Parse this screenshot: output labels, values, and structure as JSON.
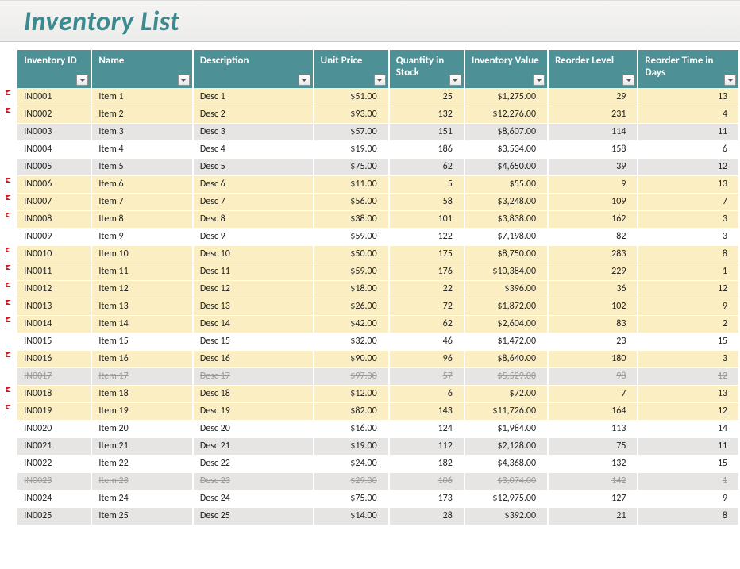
{
  "title": "Inventory List",
  "columns": {
    "id": "Inventory ID",
    "name": "Name",
    "desc": "Description",
    "price": "Unit Price",
    "qty": "Quantity in Stock",
    "val": "Inventory Value",
    "rlvl": "Reorder Level",
    "rtime": "Reorder Time in Days"
  },
  "rows": [
    {
      "flag": true,
      "hl": true,
      "id": "IN0001",
      "name": "Item 1",
      "desc": "Desc 1",
      "price": "$51.00",
      "qty": "25",
      "val": "$1,275.00",
      "rlvl": "29",
      "rtime": "13"
    },
    {
      "flag": true,
      "hl": true,
      "id": "IN0002",
      "name": "Item 2",
      "desc": "Desc 2",
      "price": "$93.00",
      "qty": "132",
      "val": "$12,276.00",
      "rlvl": "231",
      "rtime": "4"
    },
    {
      "flag": false,
      "hl": false,
      "gray": true,
      "id": "IN0003",
      "name": "Item 3",
      "desc": "Desc 3",
      "price": "$57.00",
      "qty": "151",
      "val": "$8,607.00",
      "rlvl": "114",
      "rtime": "11"
    },
    {
      "flag": false,
      "hl": false,
      "id": "IN0004",
      "name": "Item 4",
      "desc": "Desc 4",
      "price": "$19.00",
      "qty": "186",
      "val": "$3,534.00",
      "rlvl": "158",
      "rtime": "6"
    },
    {
      "flag": false,
      "hl": false,
      "gray": true,
      "id": "IN0005",
      "name": "Item 5",
      "desc": "Desc 5",
      "price": "$75.00",
      "qty": "62",
      "val": "$4,650.00",
      "rlvl": "39",
      "rtime": "12"
    },
    {
      "flag": true,
      "hl": true,
      "id": "IN0006",
      "name": "Item 6",
      "desc": "Desc 6",
      "price": "$11.00",
      "qty": "5",
      "val": "$55.00",
      "rlvl": "9",
      "rtime": "13"
    },
    {
      "flag": true,
      "hl": true,
      "id": "IN0007",
      "name": "Item 7",
      "desc": "Desc 7",
      "price": "$56.00",
      "qty": "58",
      "val": "$3,248.00",
      "rlvl": "109",
      "rtime": "7"
    },
    {
      "flag": true,
      "hl": true,
      "id": "IN0008",
      "name": "Item 8",
      "desc": "Desc 8",
      "price": "$38.00",
      "qty": "101",
      "val": "$3,838.00",
      "rlvl": "162",
      "rtime": "3"
    },
    {
      "flag": false,
      "hl": false,
      "id": "IN0009",
      "name": "Item 9",
      "desc": "Desc 9",
      "price": "$59.00",
      "qty": "122",
      "val": "$7,198.00",
      "rlvl": "82",
      "rtime": "3"
    },
    {
      "flag": true,
      "hl": true,
      "id": "IN0010",
      "name": "Item 10",
      "desc": "Desc 10",
      "price": "$50.00",
      "qty": "175",
      "val": "$8,750.00",
      "rlvl": "283",
      "rtime": "8"
    },
    {
      "flag": true,
      "hl": true,
      "id": "IN0011",
      "name": "Item 11",
      "desc": "Desc 11",
      "price": "$59.00",
      "qty": "176",
      "val": "$10,384.00",
      "rlvl": "229",
      "rtime": "1"
    },
    {
      "flag": true,
      "hl": true,
      "id": "IN0012",
      "name": "Item 12",
      "desc": "Desc 12",
      "price": "$18.00",
      "qty": "22",
      "val": "$396.00",
      "rlvl": "36",
      "rtime": "12"
    },
    {
      "flag": true,
      "hl": true,
      "id": "IN0013",
      "name": "Item 13",
      "desc": "Desc 13",
      "price": "$26.00",
      "qty": "72",
      "val": "$1,872.00",
      "rlvl": "102",
      "rtime": "9"
    },
    {
      "flag": true,
      "hl": true,
      "id": "IN0014",
      "name": "Item 14",
      "desc": "Desc 14",
      "price": "$42.00",
      "qty": "62",
      "val": "$2,604.00",
      "rlvl": "83",
      "rtime": "2"
    },
    {
      "flag": false,
      "hl": false,
      "id": "IN0015",
      "name": "Item 15",
      "desc": "Desc 15",
      "price": "$32.00",
      "qty": "46",
      "val": "$1,472.00",
      "rlvl": "23",
      "rtime": "15"
    },
    {
      "flag": true,
      "hl": true,
      "id": "IN0016",
      "name": "Item 16",
      "desc": "Desc 16",
      "price": "$90.00",
      "qty": "96",
      "val": "$8,640.00",
      "rlvl": "180",
      "rtime": "3"
    },
    {
      "flag": false,
      "hl": false,
      "gray": true,
      "disc": true,
      "id": "IN0017",
      "name": "Item 17",
      "desc": "Desc 17",
      "price": "$97.00",
      "qty": "57",
      "val": "$5,529.00",
      "rlvl": "98",
      "rtime": "12"
    },
    {
      "flag": true,
      "hl": true,
      "id": "IN0018",
      "name": "Item 18",
      "desc": "Desc 18",
      "price": "$12.00",
      "qty": "6",
      "val": "$72.00",
      "rlvl": "7",
      "rtime": "13"
    },
    {
      "flag": true,
      "hl": true,
      "id": "IN0019",
      "name": "Item 19",
      "desc": "Desc 19",
      "price": "$82.00",
      "qty": "143",
      "val": "$11,726.00",
      "rlvl": "164",
      "rtime": "12"
    },
    {
      "flag": false,
      "hl": false,
      "id": "IN0020",
      "name": "Item 20",
      "desc": "Desc 20",
      "price": "$16.00",
      "qty": "124",
      "val": "$1,984.00",
      "rlvl": "113",
      "rtime": "14"
    },
    {
      "flag": false,
      "hl": false,
      "gray": true,
      "id": "IN0021",
      "name": "Item 21",
      "desc": "Desc 21",
      "price": "$19.00",
      "qty": "112",
      "val": "$2,128.00",
      "rlvl": "75",
      "rtime": "11"
    },
    {
      "flag": false,
      "hl": false,
      "id": "IN0022",
      "name": "Item 22",
      "desc": "Desc 22",
      "price": "$24.00",
      "qty": "182",
      "val": "$4,368.00",
      "rlvl": "132",
      "rtime": "15"
    },
    {
      "flag": false,
      "hl": false,
      "gray": true,
      "disc": true,
      "id": "IN0023",
      "name": "Item 23",
      "desc": "Desc 23",
      "price": "$29.00",
      "qty": "106",
      "val": "$3,074.00",
      "rlvl": "142",
      "rtime": "1"
    },
    {
      "flag": false,
      "hl": false,
      "id": "IN0024",
      "name": "Item 24",
      "desc": "Desc 24",
      "price": "$75.00",
      "qty": "173",
      "val": "$12,975.00",
      "rlvl": "127",
      "rtime": "9"
    },
    {
      "flag": false,
      "hl": false,
      "gray": true,
      "id": "IN0025",
      "name": "Item 25",
      "desc": "Desc 25",
      "price": "$14.00",
      "qty": "28",
      "val": "$392.00",
      "rlvl": "21",
      "rtime": "8"
    }
  ]
}
